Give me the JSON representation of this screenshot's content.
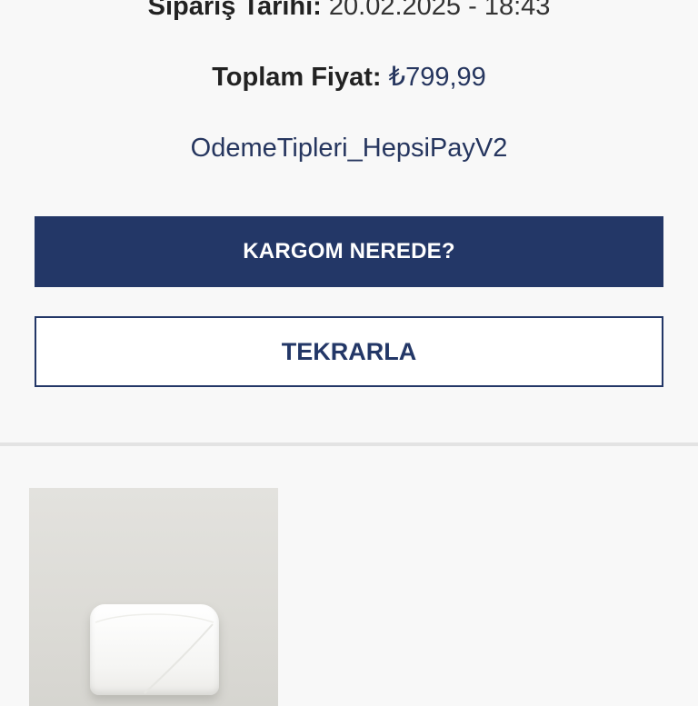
{
  "order": {
    "date_label": "Sipariş Tarihi:",
    "date_value": "20.02.2025 - 18:43",
    "total_label": "Toplam Fiyat:",
    "total_value": "₺799,99",
    "payment_type": "OdemeTipleri_HepsiPayV2"
  },
  "actions": {
    "track_label": "KARGOM NEREDE?",
    "repeat_label": "TEKRARLA"
  },
  "colors": {
    "primary": "#233767",
    "background": "#f8f8f8",
    "divider": "#e3e3e3"
  }
}
